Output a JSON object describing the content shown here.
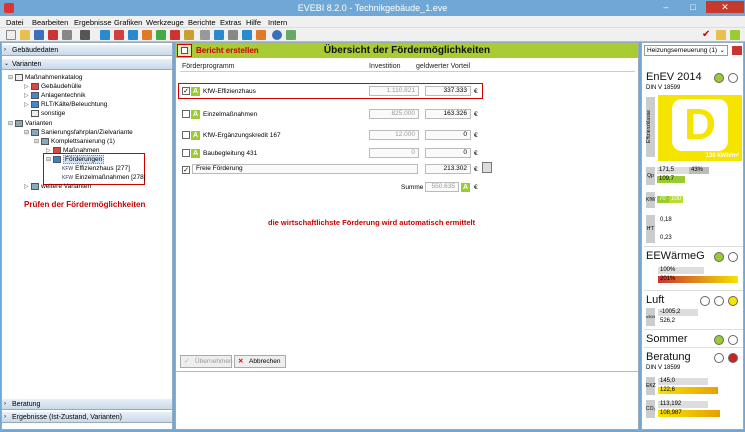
{
  "window": {
    "title": "EVEBI 8.2.0 - Technikgebäude_1.eve",
    "min": "–",
    "max": "□",
    "close": "✕"
  },
  "menu": [
    "Datei",
    "Bearbeiten",
    "Ergebnisse",
    "Grafiken",
    "Werkzeuge",
    "Berichte",
    "Extras",
    "Hilfe",
    "Intern"
  ],
  "left": {
    "gebaeudedaten": "Gebäudedaten",
    "varianten": "Varianten",
    "tree": [
      "Maßnahmenkatalog",
      "Gebäudehülle",
      "Anlagentechnik",
      "RLT/Kälte/Beleuchtung",
      "sonstige",
      "Varianten",
      "Sanierungsfahrplan/Zielvariante",
      "Komplettsanierung (1)",
      "Maßnahmen",
      "Förderungen",
      "Effizienzhaus [277]",
      "Einzelmaßnahmen [278]",
      "weitere Varianten"
    ],
    "kfw": "KFW",
    "annotation": "Prüfen der Fördermöglichkeiten",
    "beratung": "Beratung",
    "ergebnisse": "Ergebnisse (Ist-Zustand, Varianten)"
  },
  "center": {
    "bericht": "Bericht erstellen",
    "title": "Übersicht der Fördermöglichkeiten",
    "col_prog": "Förderprogramm",
    "col_inv": "Investition",
    "col_vorteil": "geldwerter Vorteil",
    "rows": [
      {
        "label": "KfW-Effizienzhaus",
        "inv": "1.110.821",
        "vorteil": "337.333",
        "checked": true
      },
      {
        "label": "Einzelmaßnahmen",
        "inv": "825.000",
        "vorteil": "163.326",
        "checked": false
      },
      {
        "label": "KfW-Ergänzungskredit 167",
        "inv": "12.000",
        "vorteil": "0",
        "checked": false
      },
      {
        "label": "Baubegleitung 431",
        "inv": "0",
        "vorteil": "0",
        "checked": false
      }
    ],
    "freie": "Freie Förderung",
    "freie_val": "213.302",
    "summe": "Summe",
    "summe_val": "550.635",
    "euro": "€",
    "A": "A",
    "annotation": "die wirtschaftlichste Förderung wird automatisch ermittelt",
    "uebernehmen": "Übernehmen",
    "abbrechen": "Abbrechen"
  },
  "right": {
    "dropdown": "Heizungserneuerung (1)",
    "enev": "EnEV 2014",
    "din": "DIN V 18599",
    "klasse": "D",
    "kwh": "130 kWh/m²",
    "effizienz": "Effizienzklasse",
    "qp": "Qp",
    "qp1": "171,5",
    "qp1b": "43%",
    "qp2": "109,7",
    "kfw": "KfW",
    "kfw1": "70",
    "kfw2": "100",
    "ht": "H'T",
    "ht1": "0,18",
    "ht2": "0,23",
    "eew": "EEWärmeG",
    "eew1": "100%",
    "eew2": "201%",
    "luft": "Luft",
    "luftlbl": "n50/inf",
    "luft1": "-1005,2",
    "luft2": "526,2",
    "sommer": "Sommer",
    "beratung": "Beratung",
    "din2": "DIN V 18599",
    "ekz": "EKZ",
    "ekz1": "145,0",
    "ekz2": "122,6",
    "co2": "CO₂",
    "co21": "113,192",
    "co22": "108,987"
  }
}
